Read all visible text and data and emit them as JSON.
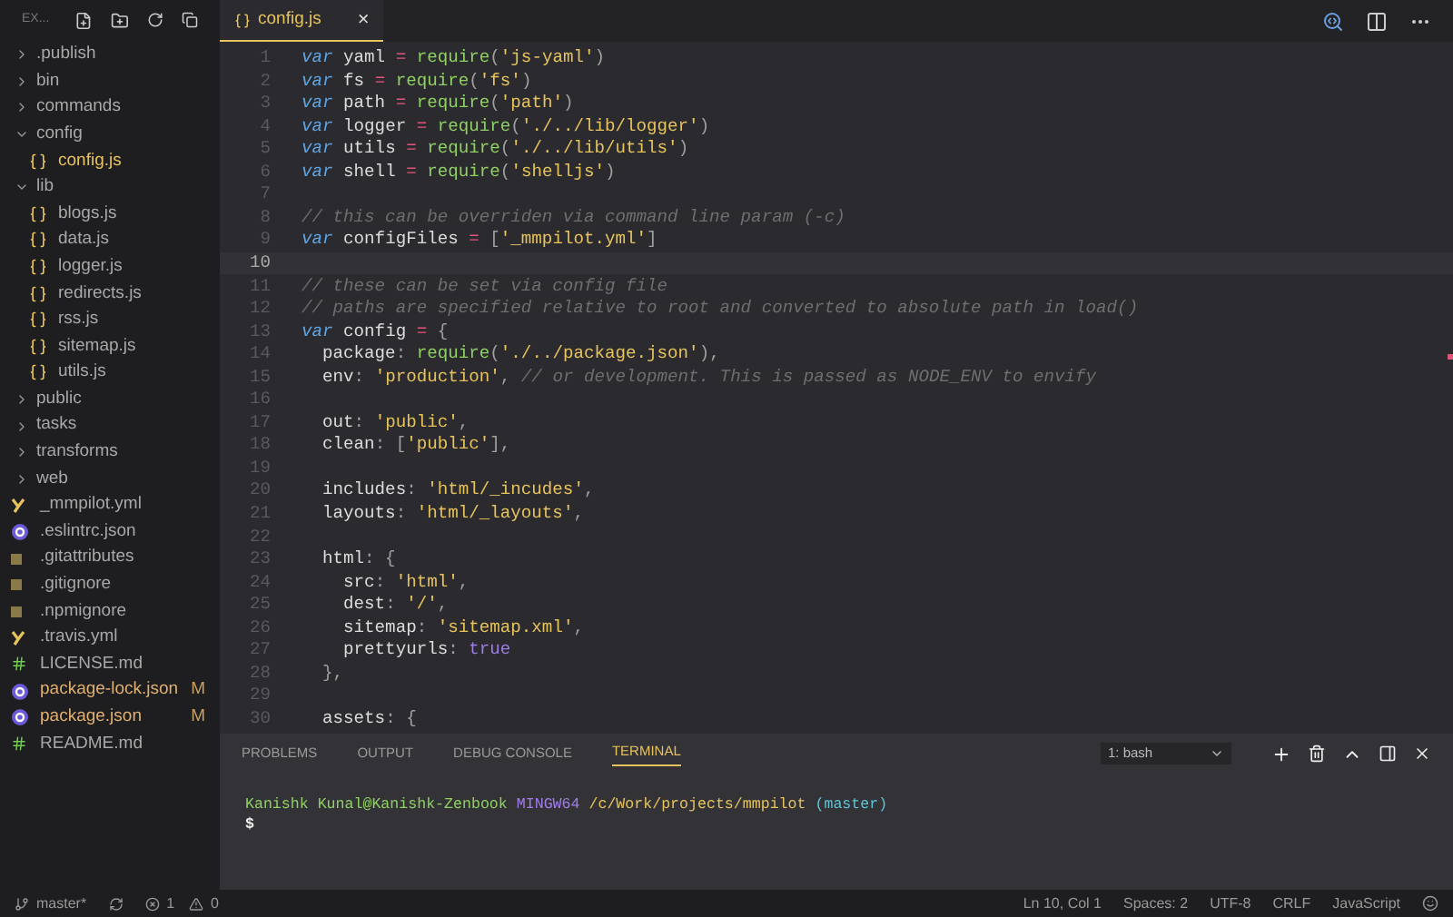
{
  "explorer": {
    "title": "EX...",
    "tree": [
      {
        "name": ".publish",
        "kind": "folder",
        "expanded": false
      },
      {
        "name": "bin",
        "kind": "folder",
        "expanded": false
      },
      {
        "name": "commands",
        "kind": "folder",
        "expanded": false
      },
      {
        "name": "config",
        "kind": "folder",
        "expanded": true,
        "children": [
          {
            "name": "config.js",
            "kind": "js",
            "selected": true
          }
        ]
      },
      {
        "name": "lib",
        "kind": "folder",
        "expanded": true,
        "children": [
          {
            "name": "blogs.js",
            "kind": "js",
            "selected": false
          },
          {
            "name": "data.js",
            "kind": "js",
            "selected": false
          },
          {
            "name": "logger.js",
            "kind": "js",
            "selected": false
          },
          {
            "name": "redirects.js",
            "kind": "js",
            "selected": false
          },
          {
            "name": "rss.js",
            "kind": "js",
            "selected": false
          },
          {
            "name": "sitemap.js",
            "kind": "js",
            "selected": false
          },
          {
            "name": "utils.js",
            "kind": "js",
            "selected": false
          }
        ]
      },
      {
        "name": "public",
        "kind": "folder",
        "expanded": false
      },
      {
        "name": "tasks",
        "kind": "folder",
        "expanded": false
      },
      {
        "name": "transforms",
        "kind": "folder",
        "expanded": false
      },
      {
        "name": "web",
        "kind": "folder",
        "expanded": false
      },
      {
        "name": "_mmpilot.yml",
        "kind": "yml",
        "selected": false
      },
      {
        "name": ".eslintrc.json",
        "kind": "json",
        "selected": false
      },
      {
        "name": ".gitattributes",
        "kind": "plain",
        "selected": false
      },
      {
        "name": ".gitignore",
        "kind": "plain",
        "selected": false
      },
      {
        "name": ".npmignore",
        "kind": "plain",
        "selected": false
      },
      {
        "name": ".travis.yml",
        "kind": "yml",
        "selected": false
      },
      {
        "name": "LICENSE.md",
        "kind": "md",
        "selected": false
      },
      {
        "name": "package-lock.json",
        "kind": "json",
        "selected": false,
        "badge": "M"
      },
      {
        "name": "package.json",
        "kind": "json",
        "selected": false,
        "badge": "M"
      },
      {
        "name": "README.md",
        "kind": "md",
        "selected": false
      }
    ]
  },
  "tabs": [
    {
      "label": "config.js",
      "selected": true,
      "close": "×"
    }
  ],
  "editor": {
    "lines": [
      {
        "number": "1",
        "current": false,
        "tokens": [
          {
            "text": "var",
            "kind": "kw"
          },
          {
            "text": " yaml ",
            "kind": "id"
          },
          {
            "text": "=",
            "kind": "op"
          },
          {
            "text": " require",
            "kind": "fn"
          },
          {
            "text": "(",
            "kind": "punc"
          },
          {
            "text": "'js-yaml'",
            "kind": "str"
          },
          {
            "text": ")",
            "kind": "punc"
          }
        ]
      },
      {
        "number": "2",
        "current": false,
        "tokens": [
          {
            "text": "var",
            "kind": "kw"
          },
          {
            "text": " fs ",
            "kind": "id"
          },
          {
            "text": "=",
            "kind": "op"
          },
          {
            "text": " require",
            "kind": "fn"
          },
          {
            "text": "(",
            "kind": "punc"
          },
          {
            "text": "'fs'",
            "kind": "str"
          },
          {
            "text": ")",
            "kind": "punc"
          }
        ]
      },
      {
        "number": "3",
        "current": false,
        "tokens": [
          {
            "text": "var",
            "kind": "kw"
          },
          {
            "text": " path ",
            "kind": "id"
          },
          {
            "text": "=",
            "kind": "op"
          },
          {
            "text": " require",
            "kind": "fn"
          },
          {
            "text": "(",
            "kind": "punc"
          },
          {
            "text": "'path'",
            "kind": "str"
          },
          {
            "text": ")",
            "kind": "punc"
          }
        ]
      },
      {
        "number": "4",
        "current": false,
        "tokens": [
          {
            "text": "var",
            "kind": "kw"
          },
          {
            "text": " logger ",
            "kind": "id"
          },
          {
            "text": "=",
            "kind": "op"
          },
          {
            "text": " require",
            "kind": "fn"
          },
          {
            "text": "(",
            "kind": "punc"
          },
          {
            "text": "'./../lib/logger'",
            "kind": "str"
          },
          {
            "text": ")",
            "kind": "punc"
          }
        ]
      },
      {
        "number": "5",
        "current": false,
        "tokens": [
          {
            "text": "var",
            "kind": "kw"
          },
          {
            "text": " utils ",
            "kind": "id"
          },
          {
            "text": "=",
            "kind": "op"
          },
          {
            "text": " require",
            "kind": "fn"
          },
          {
            "text": "(",
            "kind": "punc"
          },
          {
            "text": "'./../lib/utils'",
            "kind": "str"
          },
          {
            "text": ")",
            "kind": "punc"
          }
        ]
      },
      {
        "number": "6",
        "current": false,
        "tokens": [
          {
            "text": "var",
            "kind": "kw"
          },
          {
            "text": " shell ",
            "kind": "id"
          },
          {
            "text": "=",
            "kind": "op"
          },
          {
            "text": " require",
            "kind": "fn"
          },
          {
            "text": "(",
            "kind": "punc"
          },
          {
            "text": "'shelljs'",
            "kind": "str"
          },
          {
            "text": ")",
            "kind": "punc"
          }
        ]
      },
      {
        "number": "7",
        "current": false
      },
      {
        "number": "8",
        "current": false,
        "tokens": [
          {
            "text": "// this can be overriden via command line param (-c)",
            "kind": "cm"
          }
        ]
      },
      {
        "number": "9",
        "current": false,
        "tokens": [
          {
            "text": "var",
            "kind": "kw"
          },
          {
            "text": " configFiles ",
            "kind": "id"
          },
          {
            "text": "=",
            "kind": "op"
          },
          {
            "text": " [",
            "kind": "punc"
          },
          {
            "text": "'_mmpilot.yml'",
            "kind": "str"
          },
          {
            "text": "]",
            "kind": "punc"
          }
        ]
      },
      {
        "number": "10",
        "current": true
      },
      {
        "number": "11",
        "current": false,
        "tokens": [
          {
            "text": "// these can be set via config file",
            "kind": "cm"
          }
        ]
      },
      {
        "number": "12",
        "current": false,
        "tokens": [
          {
            "text": "// paths are specified relative to root and converted to absolute path in load()",
            "kind": "cm"
          }
        ]
      },
      {
        "number": "13",
        "current": false,
        "tokens": [
          {
            "text": "var",
            "kind": "kw"
          },
          {
            "text": " config ",
            "kind": "id"
          },
          {
            "text": "=",
            "kind": "op"
          },
          {
            "text": " {",
            "kind": "punc"
          }
        ]
      },
      {
        "number": "14",
        "current": false,
        "tokens": [
          {
            "text": "  package",
            "kind": "id"
          },
          {
            "text": ": ",
            "kind": "punc"
          },
          {
            "text": "require",
            "kind": "fn"
          },
          {
            "text": "(",
            "kind": "punc"
          },
          {
            "text": "'./../package.json'",
            "kind": "str"
          },
          {
            "text": "),",
            "kind": "punc"
          }
        ]
      },
      {
        "number": "15",
        "current": false,
        "tokens": [
          {
            "text": "  env",
            "kind": "id"
          },
          {
            "text": ": ",
            "kind": "punc"
          },
          {
            "text": "'production'",
            "kind": "str"
          },
          {
            "text": ", ",
            "kind": "punc"
          },
          {
            "text": "// or development. This is passed as NODE_ENV to envify",
            "kind": "cm"
          }
        ]
      },
      {
        "number": "16",
        "current": false
      },
      {
        "number": "17",
        "current": false,
        "tokens": [
          {
            "text": "  out",
            "kind": "id"
          },
          {
            "text": ": ",
            "kind": "punc"
          },
          {
            "text": "'public'",
            "kind": "str"
          },
          {
            "text": ",",
            "kind": "punc"
          }
        ]
      },
      {
        "number": "18",
        "current": false,
        "tokens": [
          {
            "text": "  clean",
            "kind": "id"
          },
          {
            "text": ": [",
            "kind": "punc"
          },
          {
            "text": "'public'",
            "kind": "str"
          },
          {
            "text": "],",
            "kind": "punc"
          }
        ]
      },
      {
        "number": "19",
        "current": false
      },
      {
        "number": "20",
        "current": false,
        "tokens": [
          {
            "text": "  includes",
            "kind": "id"
          },
          {
            "text": ": ",
            "kind": "punc"
          },
          {
            "text": "'html/_incudes'",
            "kind": "str"
          },
          {
            "text": ",",
            "kind": "punc"
          }
        ]
      },
      {
        "number": "21",
        "current": false,
        "tokens": [
          {
            "text": "  layouts",
            "kind": "id"
          },
          {
            "text": ": ",
            "kind": "punc"
          },
          {
            "text": "'html/_layouts'",
            "kind": "str"
          },
          {
            "text": ",",
            "kind": "punc"
          }
        ]
      },
      {
        "number": "22",
        "current": false
      },
      {
        "number": "23",
        "current": false,
        "tokens": [
          {
            "text": "  html",
            "kind": "id"
          },
          {
            "text": ": {",
            "kind": "punc"
          }
        ]
      },
      {
        "number": "24",
        "current": false,
        "tokens": [
          {
            "text": "    src",
            "kind": "id"
          },
          {
            "text": ": ",
            "kind": "punc"
          },
          {
            "text": "'html'",
            "kind": "str"
          },
          {
            "text": ",",
            "kind": "punc"
          }
        ]
      },
      {
        "number": "25",
        "current": false,
        "tokens": [
          {
            "text": "    dest",
            "kind": "id"
          },
          {
            "text": ": ",
            "kind": "punc"
          },
          {
            "text": "'/'",
            "kind": "str"
          },
          {
            "text": ",",
            "kind": "punc"
          }
        ]
      },
      {
        "number": "26",
        "current": false,
        "tokens": [
          {
            "text": "    sitemap",
            "kind": "id"
          },
          {
            "text": ": ",
            "kind": "punc"
          },
          {
            "text": "'sitemap.xml'",
            "kind": "str"
          },
          {
            "text": ",",
            "kind": "punc"
          }
        ]
      },
      {
        "number": "27",
        "current": false,
        "tokens": [
          {
            "text": "    prettyurls",
            "kind": "id"
          },
          {
            "text": ": ",
            "kind": "punc"
          },
          {
            "text": "true",
            "kind": "bool"
          }
        ]
      },
      {
        "number": "28",
        "current": false,
        "tokens": [
          {
            "text": "  },",
            "kind": "punc"
          }
        ]
      },
      {
        "number": "29",
        "current": false
      },
      {
        "number": "30",
        "current": false,
        "tokens": [
          {
            "text": "  assets",
            "kind": "id"
          },
          {
            "text": ": {",
            "kind": "punc"
          }
        ]
      }
    ]
  },
  "panel": {
    "tabs": [
      {
        "label": "PROBLEMS",
        "selected": false
      },
      {
        "label": "OUTPUT",
        "selected": false
      },
      {
        "label": "DEBUG CONSOLE",
        "selected": false
      },
      {
        "label": "TERMINAL",
        "selected": true
      }
    ],
    "terminal_select": "1: bash",
    "terminal": {
      "user": "Kanishk Kunal@Kanishk-Zenbook",
      "system": "MINGW64",
      "path": "/c/Work/projects/mmpilot",
      "branch": "(master)",
      "prompt": "$"
    }
  },
  "status_bar": {
    "branch": "master*",
    "errors": "1",
    "warnings": "0",
    "position": "Ln 10, Col 1",
    "spaces": "Spaces: 2",
    "encoding": "UTF-8",
    "eol": "CRLF",
    "language": "JavaScript"
  }
}
